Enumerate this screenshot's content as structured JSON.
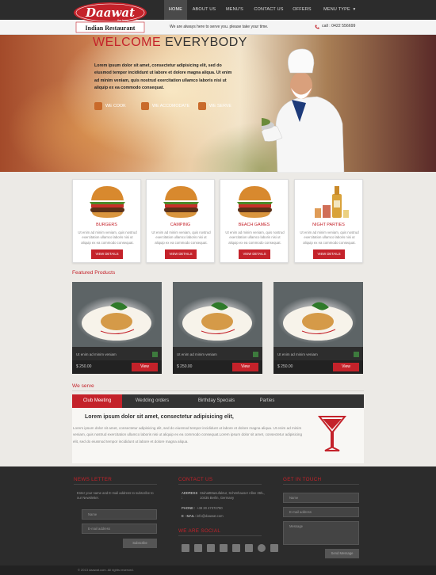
{
  "brand": {
    "name": "Daawat",
    "tag": "the feast",
    "sub": "Indian Restaurant"
  },
  "nav": [
    "HOME",
    "ABOUT US",
    "MENU'S",
    "CONTACT US",
    "OFFERS",
    "MENU TYPE"
  ],
  "subbar": {
    "tagline": "We are always here to serve you. please take your time.",
    "call": "call : 0422 556699"
  },
  "hero": {
    "title_a": "WELCOME",
    "title_b": "EVERYBODY",
    "text": "Lorem ipsum dolor sit amet, consectetur adipisicing elit, sed do eiusmod tempor incididunt ut labore et dolore magna aliqua. Ut enim ad minim veniam, quis nostrud exercitation ullamco laboris nisi ut aliquip ex ea commodo consequat.",
    "features": [
      "WE COOK",
      "WE ACCOMODATE",
      "WE SERVE"
    ]
  },
  "cards": [
    {
      "title": "BURGERS",
      "text": "Ut enim ad minim veniam, quis nostrud exercitation ullamco laboris nisi ut aliquip ex ea commodo consequat.",
      "button": "VIEW DETAILS"
    },
    {
      "title": "CAMPING",
      "text": "Ut enim ad minim veniam, quis nostrud exercitation ullamco laboris nisi ut aliquip ex ea commodo consequat.",
      "button": "VIEW DETAILS"
    },
    {
      "title": "BEACH GAMES",
      "text": "Ut enim ad minim veniam, quis nostrud exercitation ullamco laboris nisi ut aliquip ex ea commodo consequat.",
      "button": "VIEW DETAILS"
    },
    {
      "title": "NIGHT PARTIES",
      "text": "Ut enim ad minim veniam, quis nostrud exercitation ullamco laboris nisi ut aliquip ex ea commodo consequat.",
      "button": "VIEW DETAILS"
    }
  ],
  "featured": {
    "title": "Featured Products",
    "items": [
      {
        "caption": "Ut enim ad minim veniam",
        "price": "$ 250.00",
        "button": "View"
      },
      {
        "caption": "Ut enim ad minim veniam",
        "price": "$ 250.00",
        "button": "View"
      },
      {
        "caption": "Ut enim ad minim veniam",
        "price": "$ 250.00",
        "button": "View"
      }
    ]
  },
  "serve": {
    "title": "We serve",
    "tabs": [
      "Club Meeting",
      "Wedding orders",
      "Birthday Specials",
      "Parties"
    ],
    "heading": "Lorem ipsum dolor sit amet, consectetur adipisicing elit,",
    "text": "Lorem ipsum dolor sit amet, consectetur adipisicing elit, sed do eiusmod tempor incididunt ut labore et dolore magna aliqua. Ut enim ad minim veniam, quis nostrud exercitation ullamco laboris nisi ut aliquip ex ea commodo consequat.Lorem ipsum dolor sit amet, consectetur adipisicing elit, sed do eiusmod tempor incididunt ut labore et dolore magna aliqua."
  },
  "footer": {
    "newsletter": {
      "title": "NEWS LETTER",
      "text": "Enter your name and E-mail address to subscribe to our Newsletter.",
      "name_ph": "Name",
      "email_ph": "E-mail address",
      "button": "Subscribe"
    },
    "contact": {
      "title": "CONTACT US",
      "address_label": "ADDRESS :",
      "address": "StuhattManufaktur, Schönhauser Allee 36/L, 10435 Berlin, Germany",
      "phone_label": "PHONE :",
      "phone": "+49 30 47372790",
      "email_label": "E - MAIL :",
      "email": "info@daawat.com"
    },
    "social_title": "WE ARE SOCIAL",
    "social_icons": [
      "facebook-icon",
      "twitter-icon",
      "linkedin-icon",
      "googleplus-icon",
      "pinterest-icon",
      "yahoo-icon",
      "skype-icon",
      "android-icon"
    ],
    "touch": {
      "title": "GET IN TOUCH",
      "name_ph": "Name",
      "email_ph": "E-mail address",
      "msg_ph": "Message",
      "button": "Send Message"
    },
    "copyright": "© 2013 daawat.com. All rights reserved."
  },
  "colors": {
    "accent": "#c4222a",
    "dark": "#2c2c2c"
  }
}
